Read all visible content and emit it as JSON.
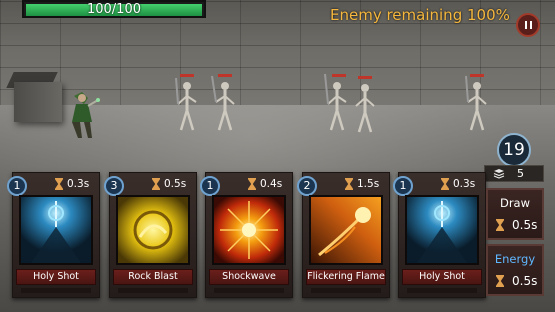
{
  "hud": {
    "hp_text": "100/100",
    "hp_fraction": 1.0,
    "enemy_remaining": "Enemy remaining 100%",
    "pause_icon": "pause-icon"
  },
  "deck": {
    "timer": "19",
    "count": "5",
    "icon": "card-stack-icon"
  },
  "cards": [
    {
      "cost": "1",
      "time": "0.3s",
      "name": "Holy Shot",
      "art": "holy-shot-icon",
      "accent": "#3fa8e0"
    },
    {
      "cost": "3",
      "time": "0.5s",
      "name": "Rock Blast",
      "art": "rock-blast-icon",
      "accent": "#e8d21a"
    },
    {
      "cost": "1",
      "time": "0.4s",
      "name": "Shockwave",
      "art": "shockwave-icon",
      "accent": "#f07a10"
    },
    {
      "cost": "2",
      "time": "1.5s",
      "name": "Flickering Flame",
      "art": "flickering-flame-icon",
      "accent": "#f09a20"
    },
    {
      "cost": "1",
      "time": "0.3s",
      "name": "Holy Shot",
      "art": "holy-shot-icon",
      "accent": "#3fa8e0"
    }
  ],
  "actions": {
    "draw": {
      "label": "Draw",
      "time": "0.5s"
    },
    "energy": {
      "label": "Energy",
      "time": "0.5s"
    }
  },
  "colors": {
    "hp_bar": "#2fb257",
    "enemy_text": "#f5b73d",
    "energy_label": "#5fb8ff",
    "card_name_bg": "#5a1a16"
  }
}
